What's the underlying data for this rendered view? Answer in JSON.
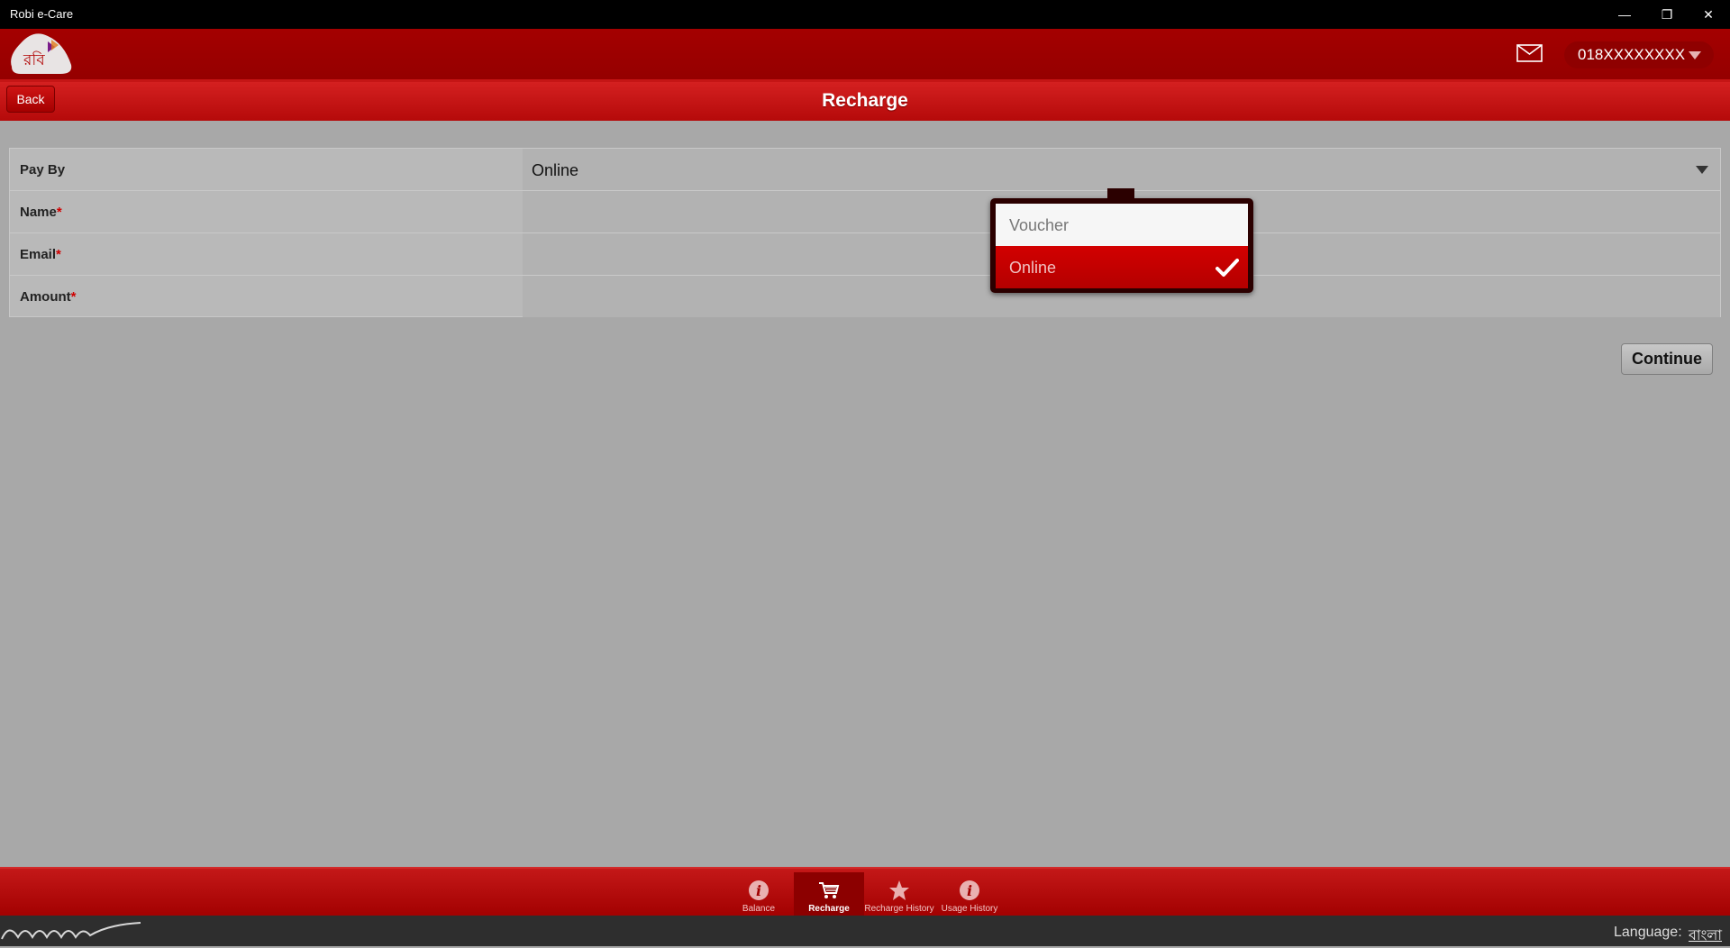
{
  "window": {
    "title": "Robi e-Care"
  },
  "header": {
    "phone_number": "018XXXXXXXX",
    "logo_text": "রবি"
  },
  "subheader": {
    "back_label": "Back",
    "page_title": "Recharge"
  },
  "form": {
    "rows": [
      {
        "label": "Pay By",
        "required": "",
        "value": "Online"
      },
      {
        "label": "Name",
        "required": "*",
        "value": ""
      },
      {
        "label": "Email",
        "required": "*",
        "value": ""
      },
      {
        "label": "Amount",
        "required": "*",
        "value": ""
      }
    ],
    "continue_label": "Continue"
  },
  "popup": {
    "options": [
      {
        "label": "Voucher",
        "selected": false
      },
      {
        "label": "Online",
        "selected": true
      }
    ]
  },
  "bottom_nav": {
    "items": [
      {
        "label": "Balance",
        "icon": "info-icon",
        "active": false
      },
      {
        "label": "Recharge",
        "icon": "cart-icon",
        "active": true
      },
      {
        "label": "Recharge History",
        "icon": "star-icon",
        "active": false
      },
      {
        "label": "Usage History",
        "icon": "info-icon",
        "active": false
      }
    ]
  },
  "footer": {
    "language_label": "Language:",
    "language_value": "বাংলা"
  },
  "colors": {
    "brand_red": "#a40000",
    "accent_red": "#d20000",
    "background": "#a8a8a8"
  }
}
